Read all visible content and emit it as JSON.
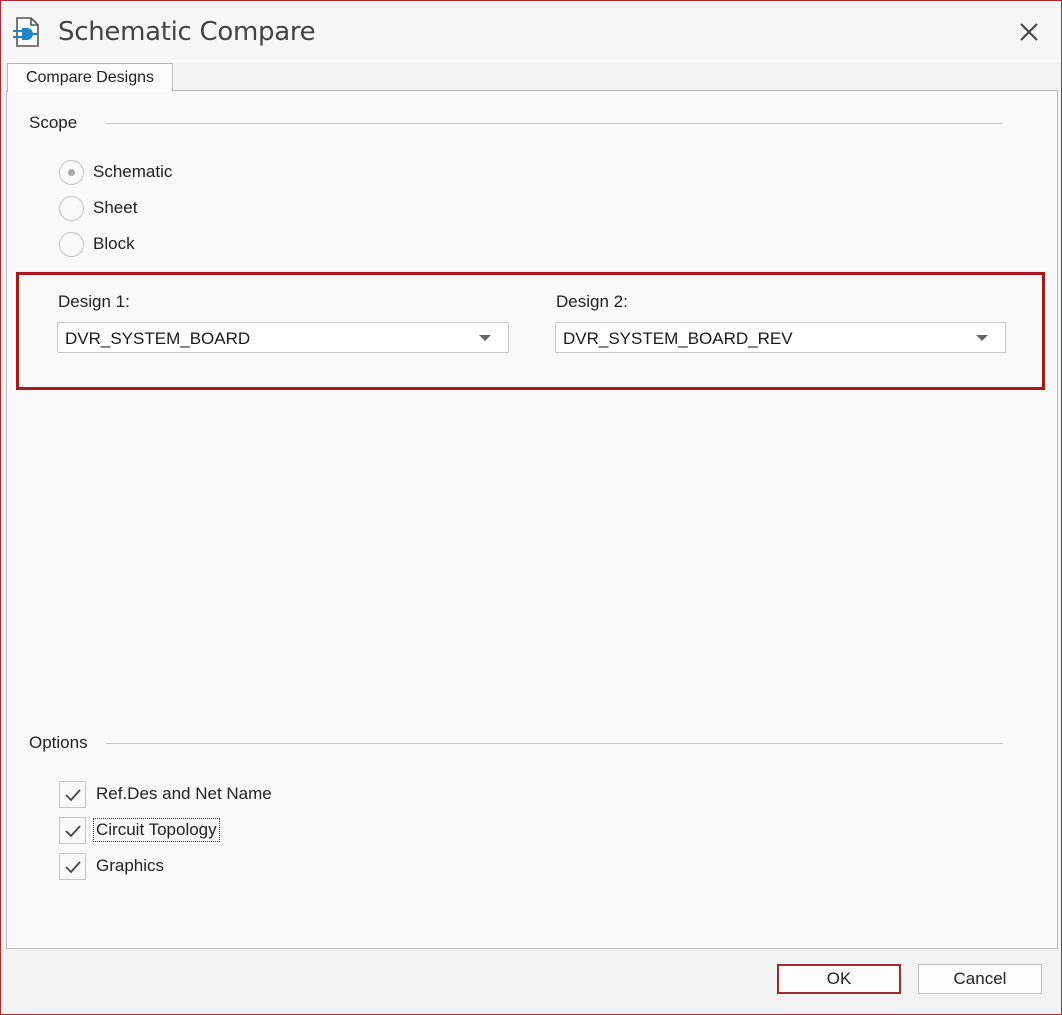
{
  "window": {
    "title": "Schematic Compare"
  },
  "tabs": [
    {
      "label": "Compare Designs"
    }
  ],
  "scope": {
    "title": "Scope",
    "options": [
      {
        "label": "Schematic",
        "checked": true
      },
      {
        "label": "Sheet",
        "checked": false
      },
      {
        "label": "Block",
        "checked": false
      }
    ]
  },
  "designs": {
    "design1": {
      "label": "Design 1:",
      "value": "DVR_SYSTEM_BOARD"
    },
    "design2": {
      "label": "Design 2:",
      "value": "DVR_SYSTEM_BOARD_REV"
    }
  },
  "options": {
    "title": "Options",
    "items": [
      {
        "label": "Ref.Des and Net Name",
        "checked": true
      },
      {
        "label": "Circuit Topology",
        "checked": true
      },
      {
        "label": "Graphics",
        "checked": true
      }
    ]
  },
  "buttons": {
    "ok": "OK",
    "cancel": "Cancel"
  },
  "colors": {
    "highlight_border": "#b0151d",
    "app_icon": "#1b86c9"
  }
}
